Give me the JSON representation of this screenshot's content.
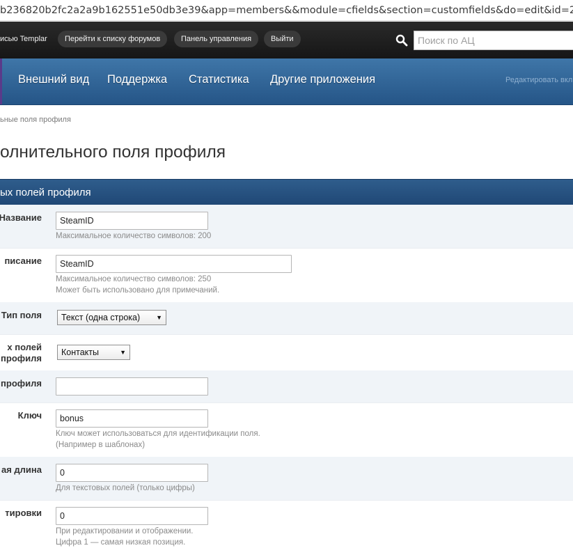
{
  "browser": {
    "url": "b236820b2fc2a2a9b162551e50db3e39&app=members&&module=cfields&section=customfields&do=edit&id=21"
  },
  "topbar": {
    "links": [
      "исью Templar",
      "Перейти к списку форумов",
      "Панель управления",
      "Выйти"
    ],
    "search_placeholder": "Поиск по АЦ"
  },
  "nav": {
    "items": [
      "Внешний вид",
      "Поддержка",
      "Статистика",
      "Другие приложения"
    ],
    "edit_tabs": "Редактировать вкл"
  },
  "breadcrumb": "ьные поля профиля",
  "page_title": "олнительного поля профиля",
  "section_header": "ых полей профиля",
  "form": {
    "name": {
      "label": "Название",
      "value": "SteamID",
      "help": "Максимальное количество символов: 200"
    },
    "description": {
      "label": "писание",
      "value": "SteamID",
      "help1": "Максимальное количество символов: 250",
      "help2": "Может быть использовано для примечаний."
    },
    "type": {
      "label": "Тип поля",
      "value": "Текст (одна строка)"
    },
    "group": {
      "label1": "х полей",
      "label2": "профиля",
      "value": "Контакты"
    },
    "profile": {
      "label": "профиля",
      "value": ""
    },
    "key": {
      "label": "Ключ",
      "value": "bonus",
      "help1": "Ключ может использоваться для идентификации поля.",
      "help2": "(Например в шаблонах)"
    },
    "max_length": {
      "label": "ая длина",
      "value": "0",
      "help": "Для текстовых полей (только цифры)"
    },
    "sort": {
      "label": "тировки",
      "value": "0",
      "help1": "При редактировании и отображении.",
      "help2": "Цифра 1 — самая низкая позиция."
    }
  }
}
